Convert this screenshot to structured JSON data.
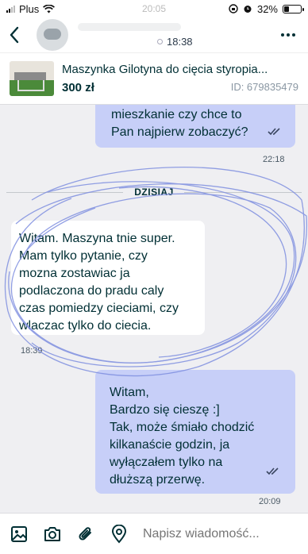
{
  "status_bar": {
    "carrier": "Plus",
    "time": "20:05",
    "battery": "32%",
    "battery_level": 0.32
  },
  "header": {
    "status_time": "18:38",
    "back_icon": "chevron-left-icon",
    "more_icon": "more-dots-icon"
  },
  "listing": {
    "title": "Maszynka Gilotyna do cięcia styropia...",
    "price": "300 zł",
    "id": "ID: 679835479"
  },
  "messages": [
    {
      "direction": "out",
      "lines": [
        "mieszkanie czy chce to",
        "Pan najpierw zobaczyć?"
      ],
      "time": "22:18",
      "read": true
    },
    {
      "direction": "in",
      "lines": [
        "Witam. Maszyna tnie super.",
        "Mam tylko pytanie, czy",
        "mozna zostawiac ja",
        "podlaczona do pradu caly",
        "czas pomiedzy cieciami, czy",
        "wlaczac tylko do ciecia."
      ],
      "time": "18:39"
    },
    {
      "direction": "out",
      "lines": [
        "Witam,",
        "Bardzo się cieszę :]",
        "Tak, może śmiało chodzić",
        "kilkanaście godzin, ja",
        "wyłączałem tylko na",
        "dłuższą przerwę."
      ],
      "time": "20:09",
      "read": true
    }
  ],
  "day_separator": "DZISIAJ",
  "composer": {
    "placeholder": "Napisz wiadomość...",
    "icons": [
      "image-icon",
      "camera-icon",
      "paperclip-icon",
      "location-pin-icon"
    ]
  },
  "colors": {
    "outgoing_bubble": "#c7cff8",
    "incoming_bubble": "#ffffff",
    "background": "#efeff2",
    "text": "#002f34",
    "scribble": "#7f8fe0"
  }
}
